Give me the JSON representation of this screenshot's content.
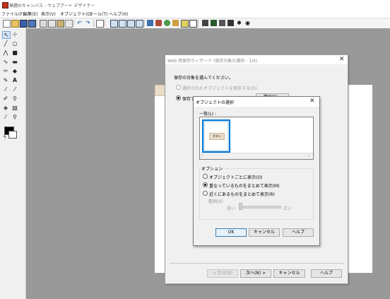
{
  "app": {
    "title": "無題のキャンバス - ウェブアート デザイナー"
  },
  "menubar": {
    "items": [
      {
        "label": "ファイル(F)"
      },
      {
        "label": "編集(E)"
      },
      {
        "label": "表示(V)"
      },
      {
        "label": "オブジェクト(O)"
      },
      {
        "label": "ツール(T)"
      },
      {
        "label": "ヘルプ(H)"
      }
    ]
  },
  "toolbar": {
    "icons": [
      "new-file-icon",
      "open-folder-icon",
      "save-icon",
      "save-web-icon",
      "cut-icon",
      "copy-icon",
      "paste-icon",
      "grid-icon",
      "undo-icon",
      "redo-icon",
      "edit-icon",
      "frame-icon",
      "text-frame-icon",
      "image-frame-icon",
      "media-icon",
      "shape-icon",
      "paint-icon",
      "color-icon",
      "group-icon",
      "align-icon",
      "settings-icon",
      "navigator-icon",
      "layer-icon",
      "effect-icon",
      "preview-icon"
    ]
  },
  "wizard": {
    "title": "Web 用保存ウィザード (保存対象の選択 - 1/4)",
    "prompt": "保存の対象を選んでください。",
    "option_selected_object": "選択されたオブジェクトを保存する(O)",
    "option_save_all": "保存するオブジェクトを選ぶ(S)",
    "select_button": "選択(E)...",
    "buttons": {
      "back": "< 戻る(B)",
      "next": "次へ(N) >",
      "cancel": "キャンセル",
      "help": "ヘルプ"
    }
  },
  "object_dialog": {
    "title": "オブジェクトの選択",
    "list_label": "一覧(L) :",
    "thumbnail_label": "ボタン",
    "options_label": "オプション",
    "option1": "オブジェクトごとに表示(O)",
    "option2": "重なっているものをまとめて表示(M)",
    "option3": "近くにあるものをまとめて表示(R)",
    "range_label": "範囲(A)",
    "range_min": "狭い",
    "range_max": "広い",
    "buttons": {
      "ok": "OK",
      "cancel": "キャンセル",
      "help": "ヘルプ"
    }
  },
  "colors": {
    "workspace": "#999999",
    "accent": "#0078d7"
  }
}
